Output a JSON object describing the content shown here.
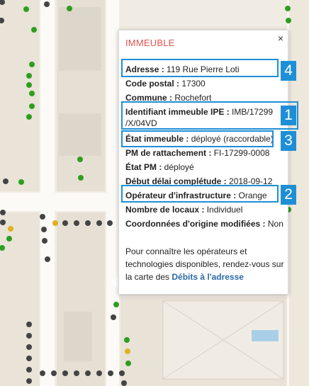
{
  "popup": {
    "title": "IMMEUBLE",
    "close_glyph": "×",
    "rows": [
      {
        "label": "Adresse :",
        "value": " 119 Rue Pierre Loti"
      },
      {
        "label": "Code postal :",
        "value": " 17300"
      },
      {
        "label": "Commune :",
        "value": " Rochefort"
      },
      {
        "label": "Identifiant immeuble IPE :",
        "value": " IMB/17299 /X/04VD"
      },
      {
        "label": "État immeuble :",
        "value": " déployé (raccordable)"
      },
      {
        "label": "PM de rattachement :",
        "value": " FI-17299-0008"
      },
      {
        "label": "État PM :",
        "value": " déployé"
      },
      {
        "label": "Début délai complétude :",
        "value": " 2018-09-12"
      },
      {
        "label": "Opérateur d'infrastructure :",
        "value": " Orange"
      },
      {
        "label": "Nombre de locaux :",
        "value": " Individuel"
      },
      {
        "label": "Coordonnées d'origine modifiées :",
        "value": " Non"
      }
    ],
    "info_text": "Pour connaître les opérateurs et technologies disponibles, rendez-vous sur la carte des ",
    "info_link": "Débits à l'adresse"
  },
  "annotations": [
    "4",
    "1",
    "3",
    "2"
  ],
  "colors": {
    "accent_blue": "#1e8fd6",
    "title_red": "#e05252",
    "dot_green": "#2e9e1f",
    "dot_dark": "#444444",
    "dot_yellow": "#e0b021"
  }
}
